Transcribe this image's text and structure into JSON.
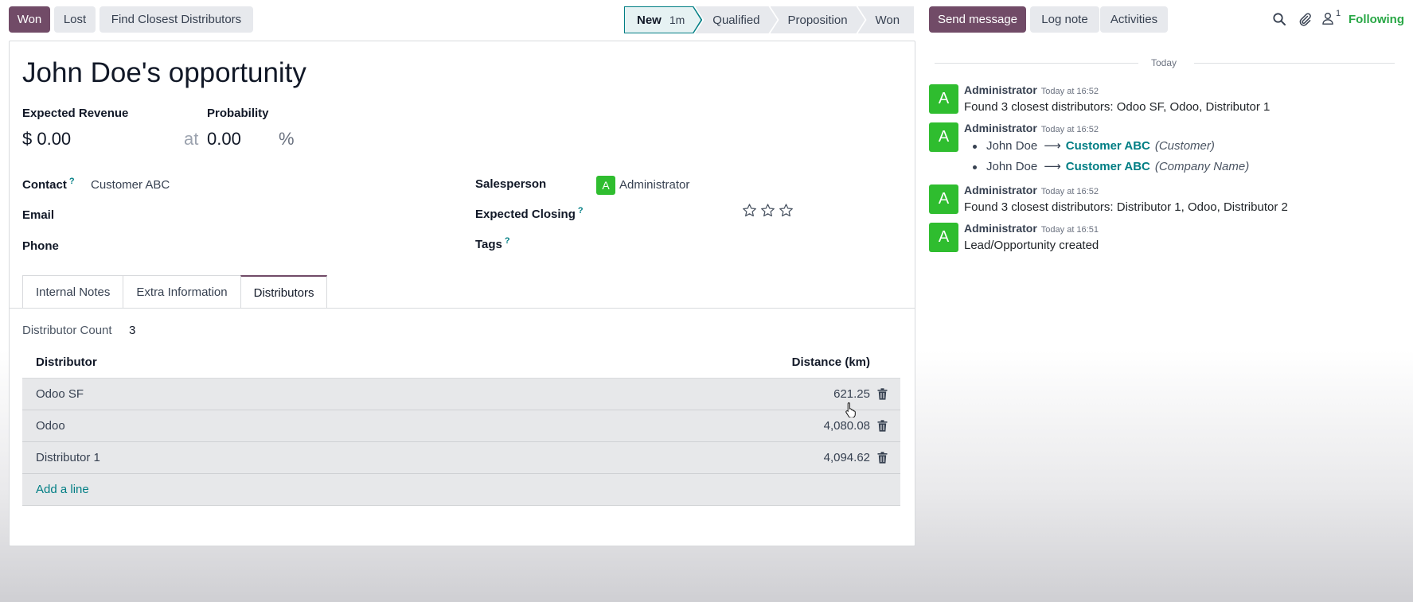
{
  "actions": {
    "won": "Won",
    "lost": "Lost",
    "find_distributors": "Find Closest Distributors"
  },
  "stages": [
    {
      "label": "New",
      "duration": "1m",
      "active": true
    },
    {
      "label": "Qualified"
    },
    {
      "label": "Proposition"
    },
    {
      "label": "Won"
    }
  ],
  "form": {
    "title": "John Doe's opportunity",
    "expected_revenue_label": "Expected Revenue",
    "expected_revenue": "$ 0.00",
    "at": "at",
    "probability_label": "Probability",
    "probability": "0.00",
    "percent": "%",
    "contact_label": "Contact",
    "contact_help": "?",
    "contact": "Customer ABC",
    "email_label": "Email",
    "phone_label": "Phone",
    "salesperson_label": "Salesperson",
    "salesperson_initial": "A",
    "salesperson": "Administrator",
    "expected_closing_label": "Expected Closing",
    "expected_closing_help": "?",
    "tags_label": "Tags",
    "tags_help": "?",
    "priority_stars": 0,
    "priority_max": 3
  },
  "tabs": [
    {
      "label": "Internal Notes"
    },
    {
      "label": "Extra Information"
    },
    {
      "label": "Distributors",
      "active": true
    }
  ],
  "distributors": {
    "count_label": "Distributor Count",
    "count": "3",
    "col_distributor": "Distributor",
    "col_distance": "Distance (km)",
    "rows": [
      {
        "name": "Odoo SF",
        "distance": "621.25"
      },
      {
        "name": "Odoo",
        "distance": "4,080.08"
      },
      {
        "name": "Distributor 1",
        "distance": "4,094.62"
      }
    ],
    "add_line": "Add a line"
  },
  "chatter": {
    "send_message": "Send message",
    "log_note": "Log note",
    "activities": "Activities",
    "followers_count": "1",
    "following": "Following",
    "date_separator": "Today",
    "messages": [
      {
        "initial": "A",
        "author": "Administrator",
        "time": "Today at 16:52",
        "body": "Found 3 closest distributors: Odoo SF, Odoo, Distributor 1"
      },
      {
        "initial": "A",
        "author": "Administrator",
        "time": "Today at 16:52",
        "changes": [
          {
            "old": "John Doe",
            "new": "Customer ABC",
            "field": "(Customer)"
          },
          {
            "old": "John Doe",
            "new": "Customer ABC",
            "field": "(Company Name)"
          }
        ]
      },
      {
        "initial": "A",
        "author": "Administrator",
        "time": "Today at 16:52",
        "body": "Found 3 closest distributors: Distributor 1, Odoo, Distributor 2"
      },
      {
        "initial": "A",
        "author": "Administrator",
        "time": "Today at 16:51",
        "body": "Lead/Opportunity created"
      }
    ]
  },
  "colors": {
    "primary": "#714b67",
    "accent": "#017e84",
    "avatar": "#2fbd2f",
    "following": "#28a745"
  }
}
